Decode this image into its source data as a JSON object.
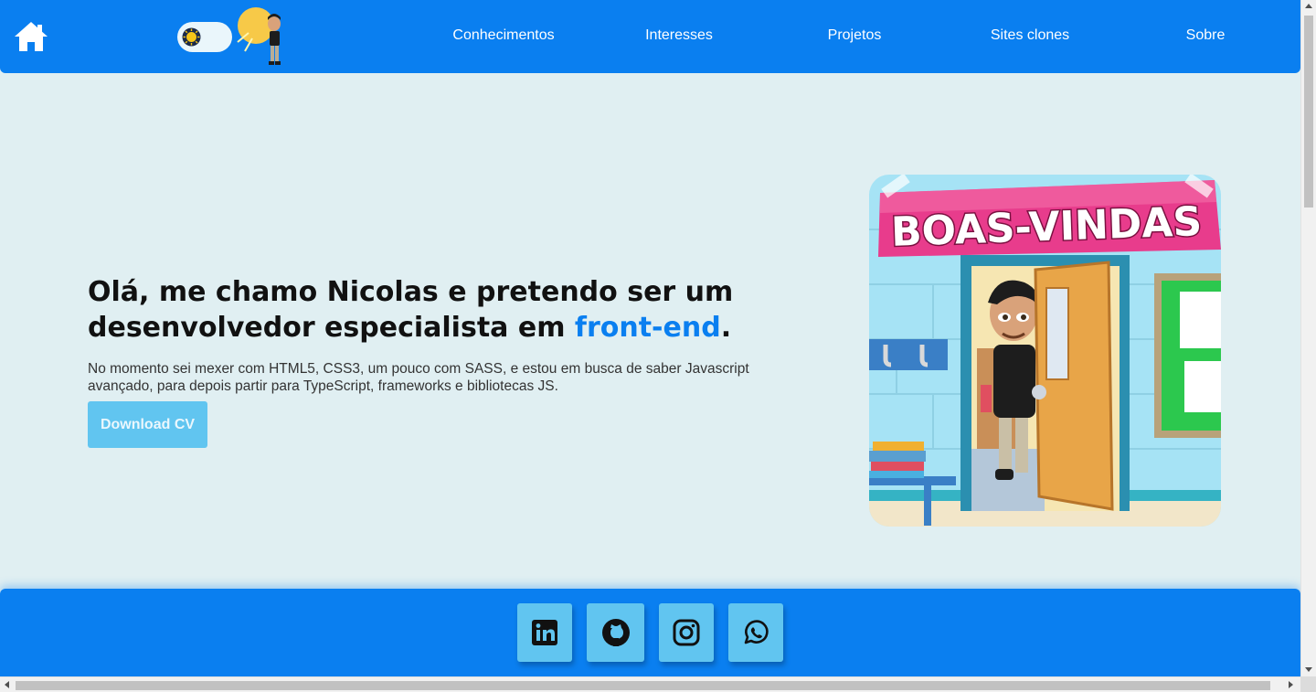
{
  "nav": {
    "items": [
      "Conhecimentos",
      "Interesses",
      "Projetos",
      "Sites clones",
      "Sobre"
    ]
  },
  "icons": {
    "home": "home-icon",
    "theme_toggle": "sun-icon",
    "linkedin": "linkedin-icon",
    "github": "github-icon",
    "instagram": "instagram-icon",
    "whatsapp": "whatsapp-icon"
  },
  "hero": {
    "title_main": "Olá, me chamo Nicolas e pretendo ser um desenvolvedor especialista em ",
    "title_accent": "front-end",
    "title_end": ".",
    "description": "No momento sei mexer com HTML5, CSS3, um pouco com SASS, e estou em busca de saber Javascript avançado, para depois partir para TypeScript, frameworks e bibliotecas JS.",
    "cv_button": "Download CV"
  },
  "welcome_image": {
    "banner_text": "BOAS-VINDAS"
  },
  "colors": {
    "primary": "#0a7ff0",
    "button": "#61c5f0",
    "background": "#e0eff2",
    "banner": "#e83c8c"
  }
}
